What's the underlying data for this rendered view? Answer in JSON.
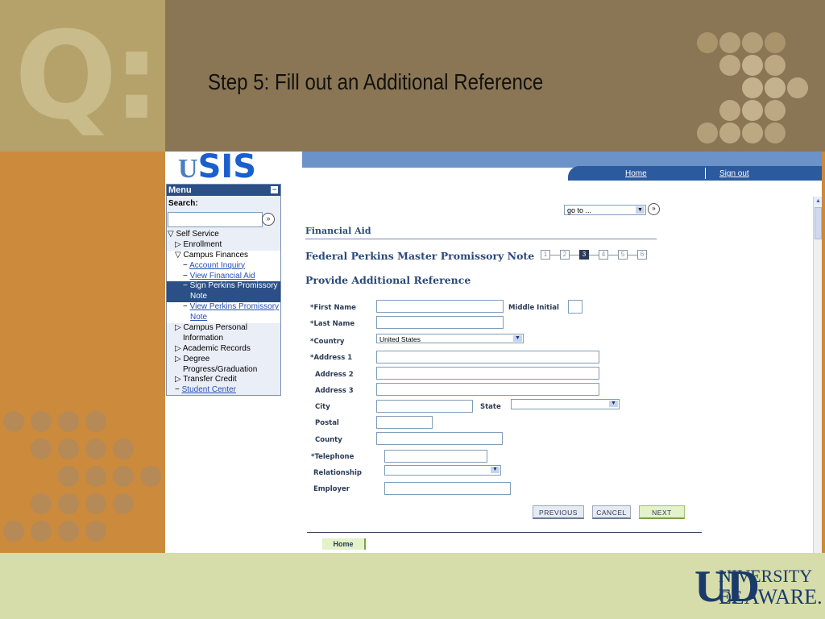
{
  "slide": {
    "title": "Step 5: Fill out an Additional Reference",
    "q_glyph": "Q:",
    "logo_ud": "UD",
    "logo_line1": "NIVERSITY OF",
    "logo_line2": "ELAWARE."
  },
  "app": {
    "logo_u": "U",
    "logo_text": "SIS",
    "header_links": {
      "home": "Home",
      "signout": "Sign out"
    }
  },
  "menu": {
    "title": "Menu",
    "minimize": "−",
    "search_label": "Search:",
    "search_go": "»",
    "items": [
      {
        "label": "▽ Self Service"
      },
      {
        "label": "▷ Enrollment"
      },
      {
        "label": "▽ Campus Finances"
      },
      {
        "label": "Account Inquiry"
      },
      {
        "label": "View Financial Aid"
      },
      {
        "label": "− Sign Perkins Promissory"
      },
      {
        "label": "Note"
      },
      {
        "label": "View Perkins Promissory"
      },
      {
        "label": "Note"
      },
      {
        "label": "▷ Campus Personal"
      },
      {
        "label": "Information"
      },
      {
        "label": "▷ Academic Records"
      },
      {
        "label": "▷ Degree"
      },
      {
        "label": "Progress/Graduation"
      },
      {
        "label": "▷ Transfer Credit"
      },
      {
        "label": "Student Center"
      }
    ]
  },
  "nav": {
    "goto_value": "go to ...",
    "goto_arrow": "▼",
    "goto_btn": "»"
  },
  "page": {
    "title": "Financial Aid",
    "subtitle": "Federal Perkins Master Promissory Note",
    "section": "Provide Additional Reference",
    "steps": [
      "1",
      "2",
      "3",
      "4",
      "5",
      "6"
    ],
    "current_step": 3
  },
  "form": {
    "first_name": "*First Name",
    "middle_initial": "Middle Initial",
    "last_name": "*Last Name",
    "country": "*Country",
    "country_value": "United States",
    "address1": "*Address 1",
    "address2": "Address 2",
    "address3": "Address 3",
    "city": "City",
    "state": "State",
    "postal": "Postal",
    "county": "County",
    "telephone": "*Telephone",
    "relationship": "Relationship",
    "employer": "Employer",
    "arrow": "▼"
  },
  "buttons": {
    "previous": "PREVIOUS",
    "cancel": "CANCEL",
    "next": "NEXT",
    "home_tab": "Home"
  },
  "scroll": {
    "up": "▲"
  }
}
